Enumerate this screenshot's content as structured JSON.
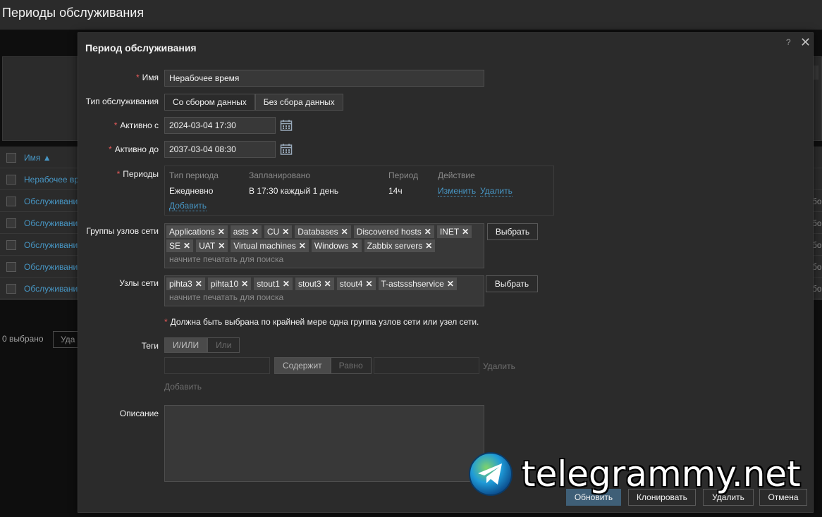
{
  "page": {
    "title": "Периоды обслуживания",
    "table_header": "Имя ▲",
    "rows": [
      "Нерабочее вр",
      "Обслуживани",
      "Обслуживани",
      "Обслуживани",
      "Обслуживани",
      "Обслуживани"
    ],
    "right_fragment": "бо",
    "selected_count": "0 выбрано",
    "bulk_delete_label": "Уда"
  },
  "dialog": {
    "title": "Период обслуживания",
    "help": "?",
    "close": "✕",
    "name": {
      "label": "Имя",
      "value": "Нерабочее время"
    },
    "maint_type": {
      "label": "Тип обслуживания",
      "options": [
        "Со сбором данных",
        "Без сбора данных"
      ],
      "selected": "Без сбора данных"
    },
    "active_since": {
      "label": "Активно с",
      "value": "2024-03-04 17:30"
    },
    "active_till": {
      "label": "Активно до",
      "value": "2037-03-04 08:30"
    },
    "periods": {
      "label": "Периоды",
      "headers": [
        "Тип периода",
        "Запланировано",
        "Период",
        "Действие"
      ],
      "row": {
        "type": "Ежедневно",
        "schedule": "В 17:30 каждый 1 день",
        "period": "14ч",
        "edit": "Изменить",
        "remove": "Удалить"
      },
      "add": "Добавить"
    },
    "host_groups": {
      "label": "Группы узлов сети",
      "tags": [
        "Applications",
        "asts",
        "CU",
        "Databases",
        "Discovered hosts",
        "INET",
        "SE",
        "UAT",
        "Virtual machines",
        "Windows",
        "Zabbix servers"
      ],
      "placeholder": "начните печатать для поиска",
      "select_btn": "Выбрать"
    },
    "hosts": {
      "label": "Узлы сети",
      "tags": [
        "pihta3",
        "pihta10",
        "stout1",
        "stout3",
        "stout4",
        "T-astssshservice"
      ],
      "placeholder": "начните печатать для поиска",
      "select_btn": "Выбрать"
    },
    "note": "Должна быть выбрана по крайней мере одна группа узлов сети или узел сети.",
    "tags": {
      "label": "Теги",
      "eval": [
        "И/ИЛИ",
        "Или"
      ],
      "operators": [
        "Содержит",
        "Равно"
      ],
      "remove": "Удалить",
      "add": "Добавить"
    },
    "description": {
      "label": "Описание",
      "value": ""
    },
    "buttons": {
      "update": "Обновить",
      "clone": "Клонировать",
      "delete": "Удалить",
      "cancel": "Отмена"
    }
  },
  "watermark": {
    "text": "telegrammy.net"
  }
}
